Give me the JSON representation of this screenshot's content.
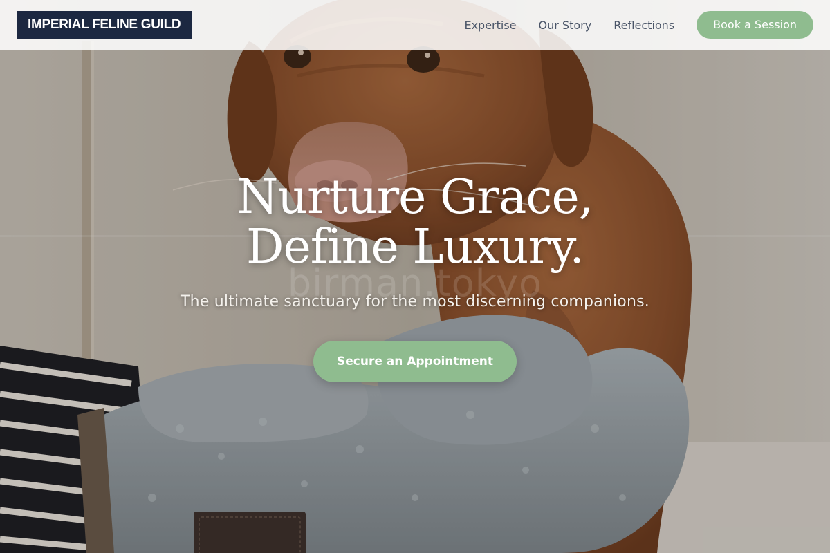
{
  "brand": {
    "logo_text": "IMPERIAL FELINE GUILD"
  },
  "nav": {
    "links": [
      "Expertise",
      "Our Story",
      "Reflections"
    ],
    "cta_label": "Book a Session"
  },
  "hero": {
    "title_line1": "Nurture Grace,",
    "title_line2": "Define Luxury.",
    "subtitle": "The ultimate sanctuary for the most discerning companions.",
    "cta_label": "Secure an Appointment",
    "watermark": "birman.tokyo",
    "background_image": "dog-being-dried-with-towel-mitts"
  },
  "colors": {
    "logo_bg": "#1c2841",
    "accent": "#8fbc8f",
    "nav_text": "#4a5568"
  }
}
